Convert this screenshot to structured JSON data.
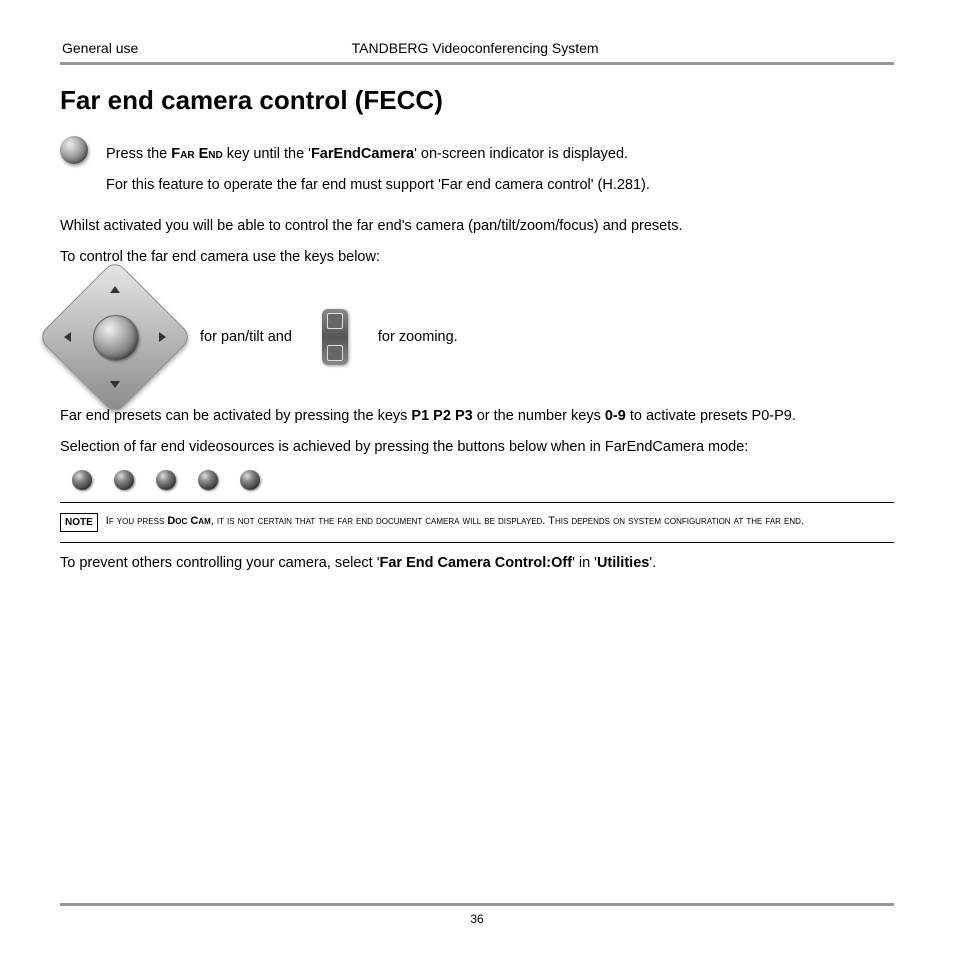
{
  "header": {
    "left": "General use",
    "center": "TANDBERG Videoconferencing System"
  },
  "title": "Far end camera control (FECC)",
  "p1_a": "Press the ",
  "p1_key": "Far End",
  "p1_b": " key until the '",
  "p1_bold": "FarEndCamera",
  "p1_c": "' on-screen indicator is displayed.",
  "p2": "For this feature to operate the far end must support 'Far end camera control' (H.281).",
  "p3": "Whilst activated you will be able to control the far end's camera (pan/tilt/zoom/focus) and presets.",
  "p4": "To control the far end camera use the keys below:",
  "ctrl_text1": "for pan/tilt and",
  "ctrl_text2": "for zooming.",
  "p5_a": "Far end presets can be activated by pressing the keys ",
  "p5_b1": "P1 P2 P3",
  "p5_b": " or the number keys ",
  "p5_b2": "0-9",
  "p5_c": " to activate presets P0-P9.",
  "p6": "Selection of far end videosources is achieved by pressing the buttons below when in FarEndCamera mode:",
  "note_label": "NOTE",
  "note_a": "If you press ",
  "note_key": "Doc Cam",
  "note_b": ", it is not certain that the far end document camera will be displayed. This depends on system configuration at the far end.",
  "p7_a": "To prevent others controlling your camera, select '",
  "p7_b1": "Far End Camera Control:Off",
  "p7_b": "' in '",
  "p7_b2": "Utilities",
  "p7_c": "'.",
  "page_number": "36"
}
